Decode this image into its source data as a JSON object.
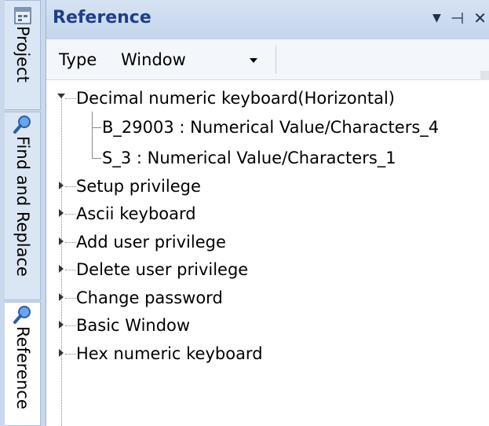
{
  "side_tabs": [
    {
      "label": "Project",
      "icon": "project-window-icon"
    },
    {
      "label": "Find and Replace",
      "icon": "magnifier-icon"
    },
    {
      "label": "Reference",
      "icon": "magnifier-icon"
    }
  ],
  "panel": {
    "title": "Reference",
    "buttons": {
      "dropdown": "▼",
      "pin": "⊣",
      "close": "✕"
    }
  },
  "toolbar": {
    "type_label": "Type",
    "type_value": "Window"
  },
  "tree": {
    "root": {
      "label": "Decimal numeric keyboard(Horizontal)",
      "children": [
        "B_29003 : Numerical Value/Characters_4",
        "S_3 : Numerical Value/Characters_1"
      ]
    },
    "collapsed_items": [
      "Setup privilege",
      "Ascii keyboard",
      "Add user privilege",
      "Delete user privilege",
      "Change password",
      "Basic Window",
      "Hex numeric keyboard"
    ]
  },
  "colors": {
    "title": "#1e3f8a",
    "titlebar_bg": "#c9d8ec",
    "side_strip_bg": "#c9d8ec"
  }
}
